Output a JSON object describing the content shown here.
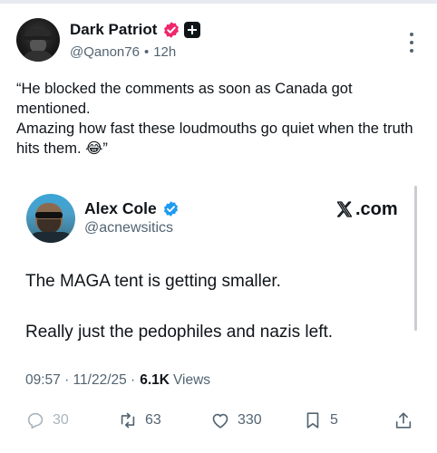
{
  "post": {
    "author": {
      "display_name": "Dark Patriot",
      "handle": "@Qanon76",
      "time": "12h",
      "separator": "•"
    },
    "text": "“He blocked the comments as soon as Canada got mentioned.\nAmazing how fast these loudmouths go quiet when the truth hits them. 😂”"
  },
  "quoted": {
    "author": {
      "display_name": "Alex Cole",
      "handle": "@acnewsitics"
    },
    "source_label": ".com",
    "text": "The MAGA tent is getting smaller.\n\nReally just the pedophiles and nazis left.",
    "timestamp": "09:57 · 11/22/25 · ",
    "views_count": "6.1K",
    "views_label": "Views",
    "actions": {
      "replies": "30",
      "reposts": "63",
      "likes": "330",
      "bookmarks": "5"
    }
  },
  "colors": {
    "text_primary": "#0f1419",
    "text_secondary": "#536471",
    "verified_pink": "#f0266b",
    "verified_blue": "#1d9bf0"
  },
  "icons": [
    "more-vertical-icon",
    "verified-badge-icon",
    "premium-plus-icon",
    "x-logo-icon",
    "reply-icon",
    "repost-icon",
    "like-icon",
    "bookmark-icon",
    "share-icon"
  ]
}
